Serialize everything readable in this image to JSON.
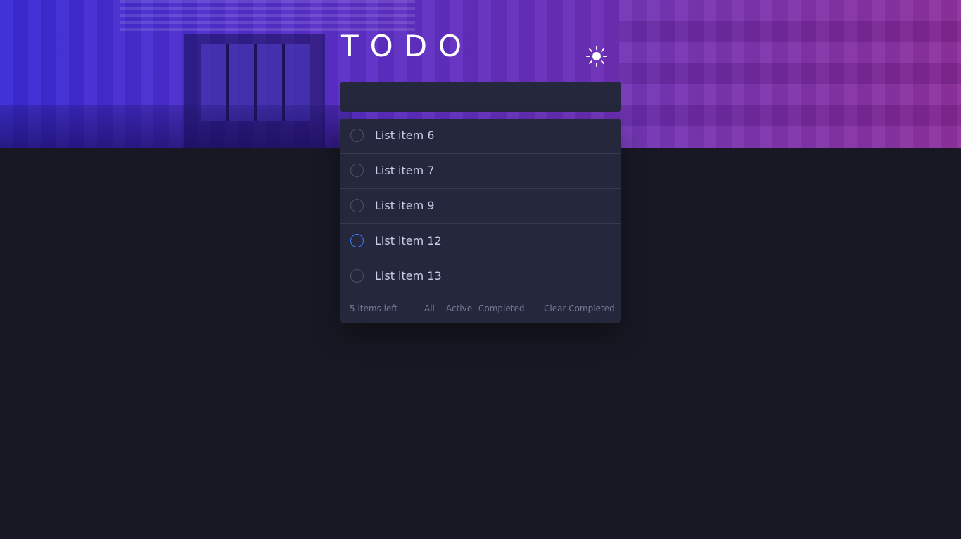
{
  "header": {
    "title": "TODO",
    "theme_icon": "sun-icon"
  },
  "new_todo": {
    "value": "",
    "placeholder": ""
  },
  "todos": [
    {
      "label": "List item 6",
      "completed": false
    },
    {
      "label": "List item 7",
      "completed": false
    },
    {
      "label": "List item 9",
      "completed": false
    },
    {
      "label": "List item 12",
      "completed": false,
      "hovered": true
    },
    {
      "label": "List item 13",
      "completed": false
    }
  ],
  "footer": {
    "items_left": "5 items left",
    "filter_all": "All",
    "filter_active": "Active",
    "filter_completed": "Completed",
    "clear_completed": "Clear Completed"
  },
  "colors": {
    "background": "#181824",
    "card": "#25273c",
    "text": "#cacde8",
    "muted": "#777a92",
    "accent": "#3a7bfd"
  }
}
